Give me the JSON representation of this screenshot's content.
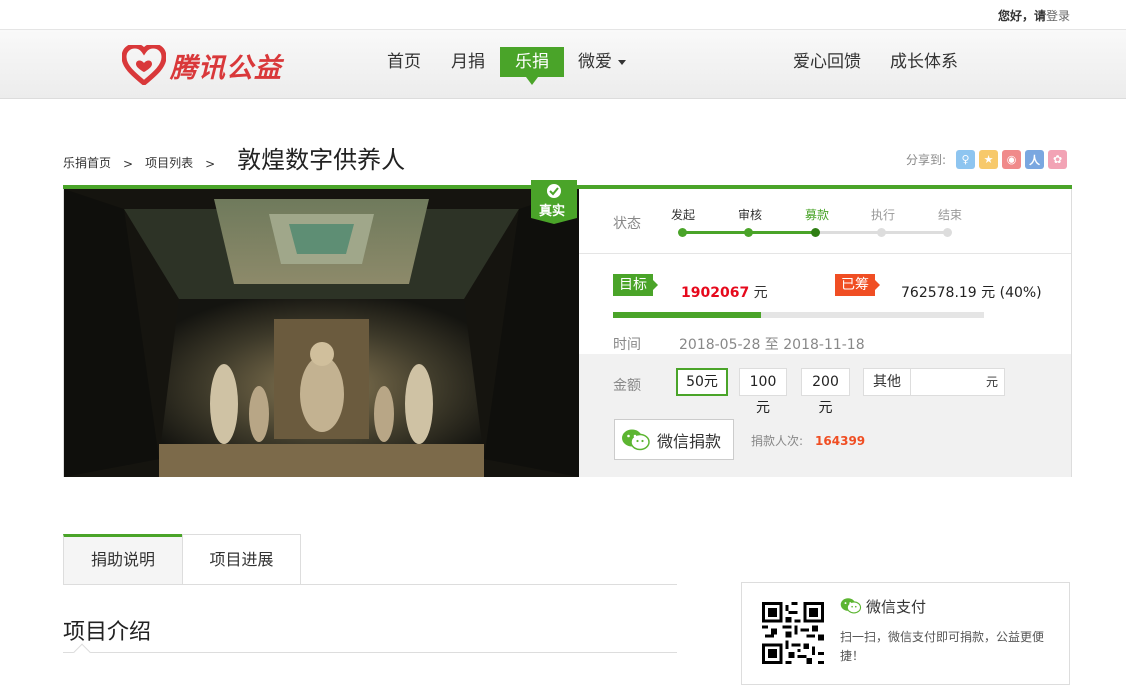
{
  "topbar": {
    "greeting": "您好，请",
    "login": "登录"
  },
  "brand": {
    "name": "腾讯公益",
    "color": "#d9383a"
  },
  "nav": {
    "items": [
      "首页",
      "月捐",
      "乐捐",
      "微爱"
    ],
    "active": "乐捐",
    "right_items": [
      "爱心回馈",
      "成长体系"
    ]
  },
  "breadcrumb": {
    "home": "乐捐首页",
    "list": "项目列表",
    "sep": ">"
  },
  "project": {
    "title": "敦煌数字供养人",
    "verified_badge": "真实",
    "image": "cave-mural-icon"
  },
  "share": {
    "label": "分享到:",
    "icons": [
      "qzone-icon",
      "favorite-icon",
      "weibo-icon",
      "renren-icon",
      "kaixin-icon"
    ]
  },
  "status": {
    "label": "状态",
    "steps": [
      "发起",
      "审核",
      "募款",
      "执行",
      "结束"
    ],
    "current_index": 2
  },
  "funding": {
    "goal_label": "目标",
    "goal_amount": "1902067",
    "goal_unit": "元",
    "raised_label": "已筹",
    "raised_text": "762578.19 元 (40%)",
    "progress": 0.4
  },
  "time": {
    "label": "时间",
    "range": "2018-05-28 至 2018-11-18"
  },
  "donate": {
    "amount_label": "金额",
    "options": [
      "50元",
      "100元",
      "200元"
    ],
    "selected": "50元",
    "other_label": "其他",
    "other_unit": "元",
    "wechat_button": "微信捐款",
    "donors_label": "捐款人次:",
    "donors_count": "164399"
  },
  "tabs": {
    "items": [
      "捐助说明",
      "项目进展"
    ],
    "active": "捐助说明"
  },
  "intro": {
    "title": "项目介绍"
  },
  "wechat_pay": {
    "title": "微信支付",
    "description": "扫一扫，微信支付即可捐款，公益更便捷！"
  },
  "colors": {
    "accent": "#4aa429",
    "highlight": "#e6091c",
    "raised_tag": "#f04e23"
  }
}
